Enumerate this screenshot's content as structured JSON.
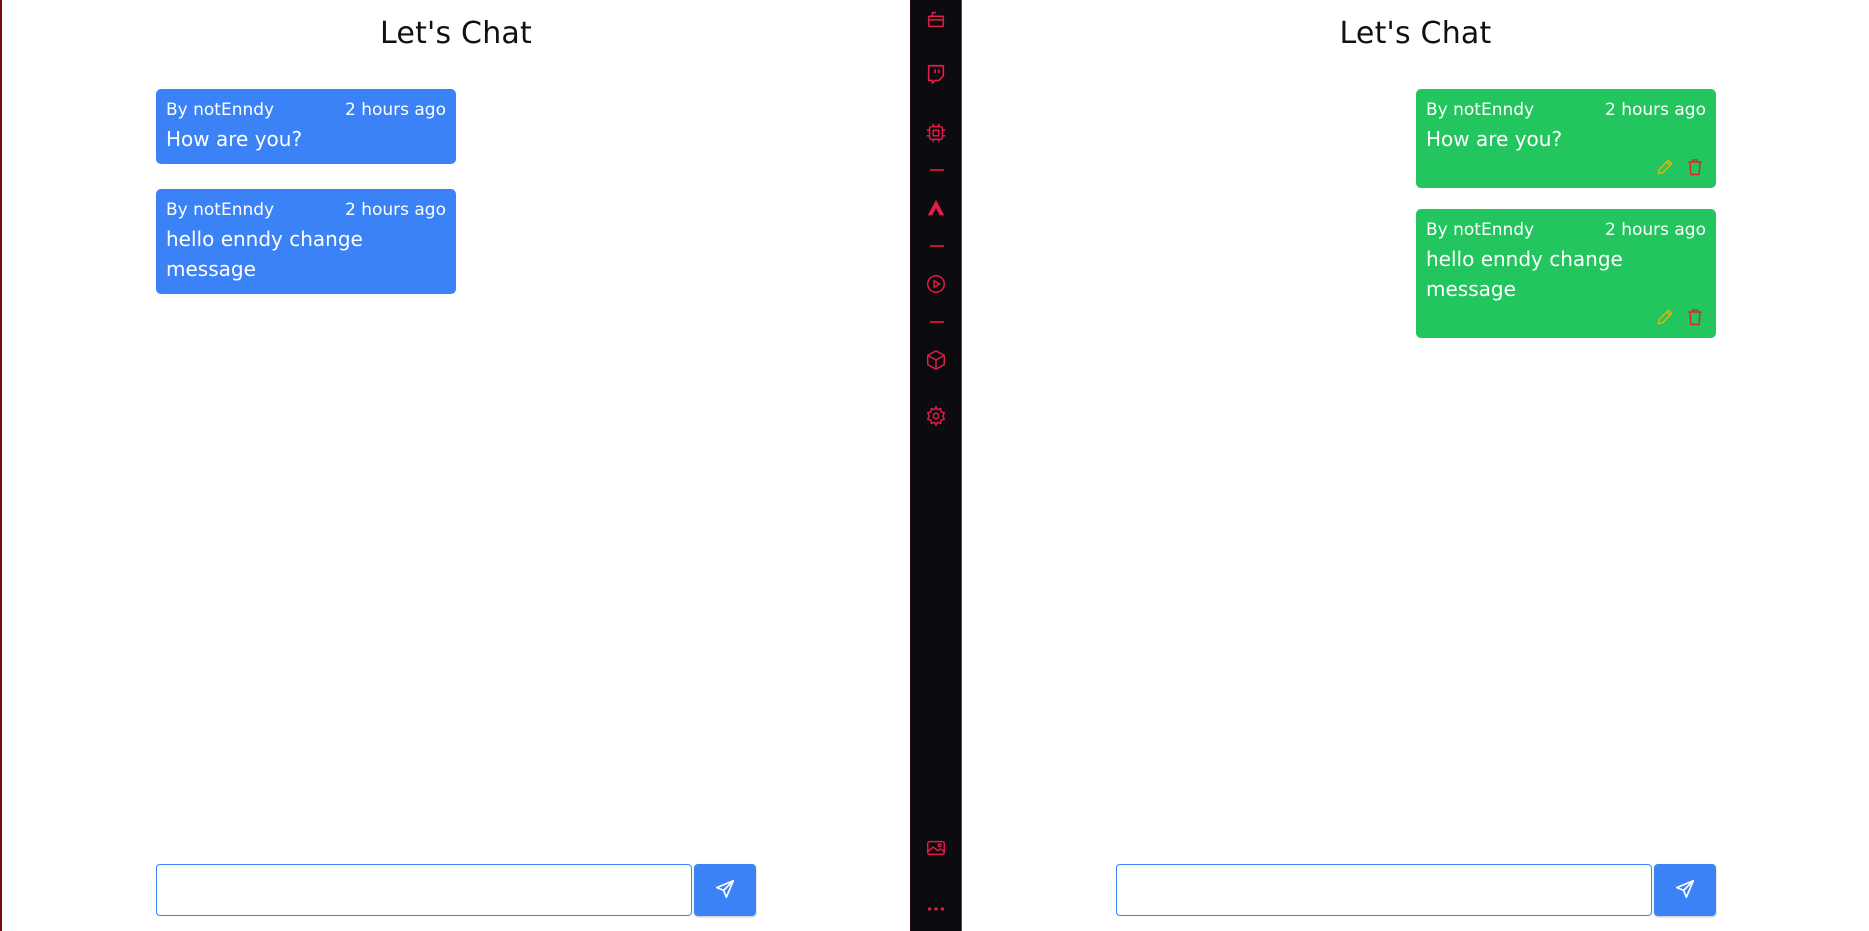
{
  "left_pane": {
    "title": "Let's Chat",
    "messages": [
      {
        "author": "By notEnndy",
        "time": "2 hours ago",
        "text": "How are you?"
      },
      {
        "author": "By notEnndy",
        "time": "2 hours ago",
        "text": "hello enndy change message"
      }
    ],
    "input": {
      "value": "",
      "placeholder": ""
    }
  },
  "right_pane": {
    "title": "Let's Chat",
    "messages": [
      {
        "author": "By notEnndy",
        "time": "2 hours ago",
        "text": "How are you?"
      },
      {
        "author": "By notEnndy",
        "time": "2 hours ago",
        "text": "hello enndy change message"
      }
    ],
    "input": {
      "value": "",
      "placeholder": ""
    }
  },
  "sidebar": {
    "icons": [
      "briefcase-icon",
      "twitch-icon",
      "chip-icon",
      "brand-a-icon",
      "play-circle-icon",
      "cube-icon",
      "gear-icon",
      "gallery-icon",
      "more-icon"
    ]
  },
  "colors": {
    "other_message": "#3b82f6",
    "own_message": "#22c55e",
    "send_button": "#3b82f6",
    "sidebar_bg": "#0b0b10",
    "sidebar_accent": "#e11d48",
    "edit_icon": "#eab308",
    "delete_icon": "#dc2626"
  }
}
